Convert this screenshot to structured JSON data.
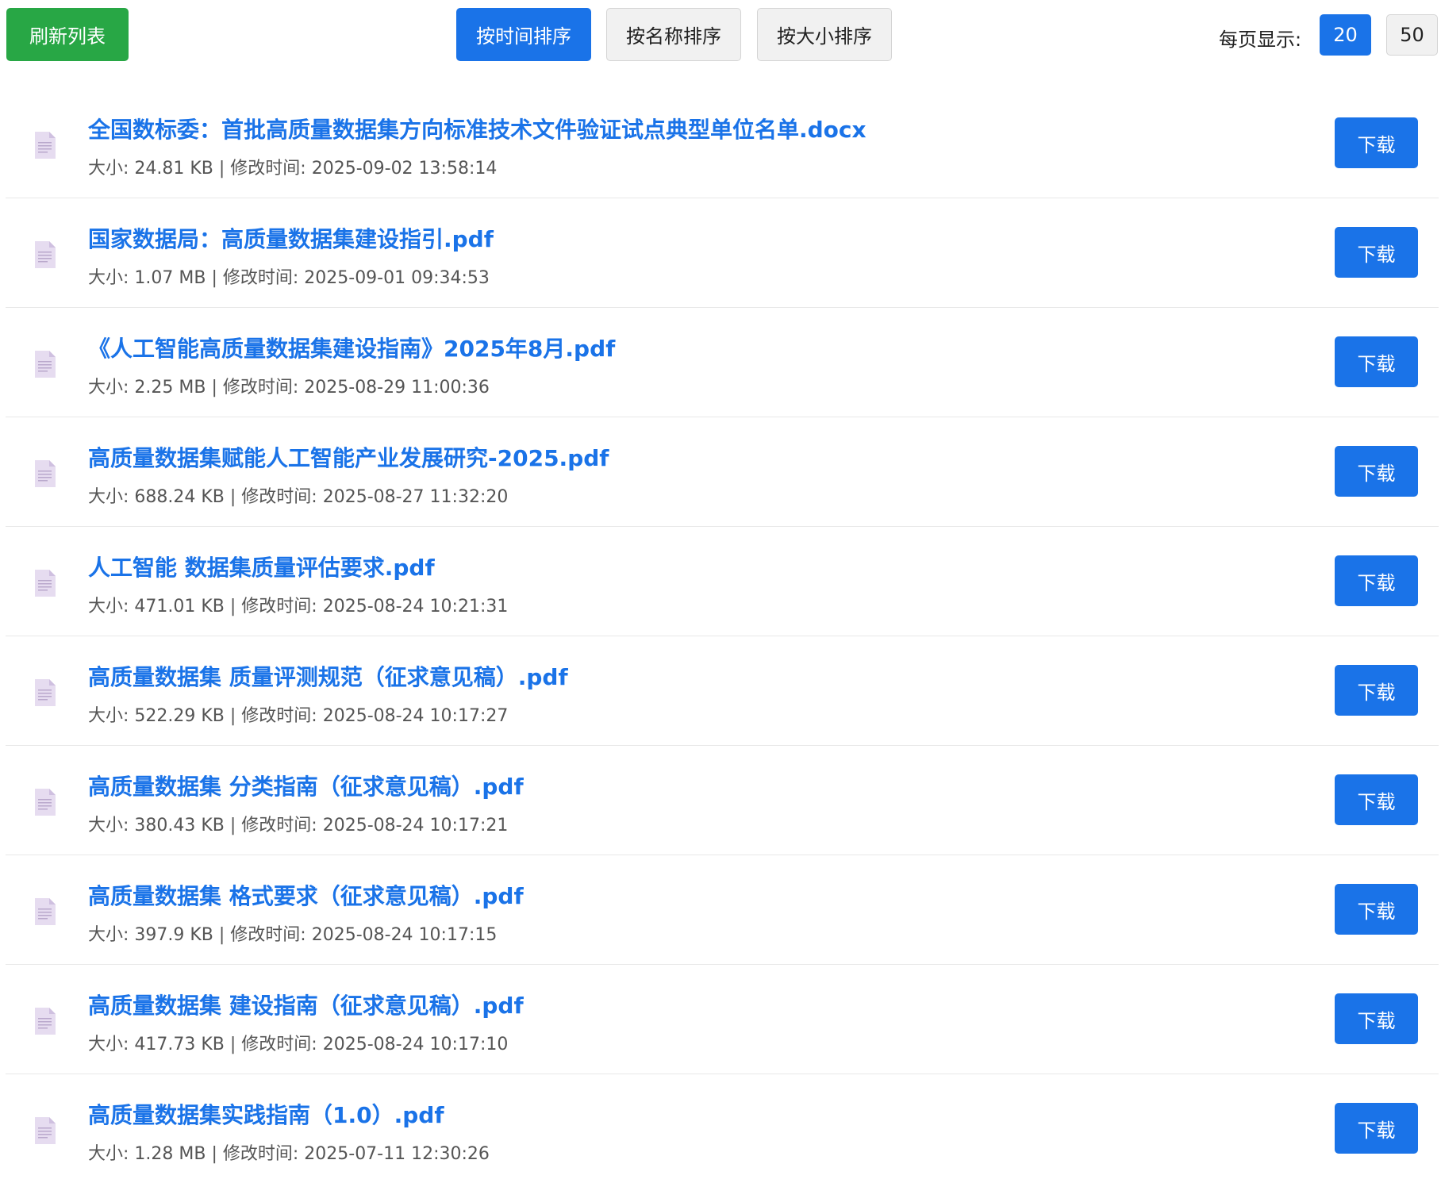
{
  "toolbar": {
    "refresh_label": "刷新列表",
    "sort_by_time_label": "按时间排序",
    "sort_by_name_label": "按名称排序",
    "sort_by_size_label": "按大小排序",
    "active_sort": "time",
    "per_page_label": "每页显示:",
    "per_page_options": [
      "20",
      "50"
    ],
    "per_page_selected": "20"
  },
  "colors": {
    "accent": "#1a73e8",
    "refresh": "#28a745",
    "file_icon": "#e6dcf0"
  },
  "file_icon": "document-icon",
  "download_label": "下载",
  "files": [
    {
      "name": "全国数标委：首批高质量数据集方向标准技术文件验证试点典型单位名单.docx",
      "meta": "大小: 24.81 KB | 修改时间: 2025-09-02 13:58:14"
    },
    {
      "name": "国家数据局：高质量数据集建设指引.pdf",
      "meta": "大小: 1.07 MB | 修改时间: 2025-09-01 09:34:53"
    },
    {
      "name": "《人工智能高质量数据集建设指南》2025年8月.pdf",
      "meta": "大小: 2.25 MB | 修改时间: 2025-08-29 11:00:36"
    },
    {
      "name": "高质量数据集赋能人工智能产业发展研究-2025.pdf",
      "meta": "大小: 688.24 KB | 修改时间: 2025-08-27 11:32:20"
    },
    {
      "name": "人工智能 数据集质量评估要求.pdf",
      "meta": "大小: 471.01 KB | 修改时间: 2025-08-24 10:21:31"
    },
    {
      "name": "高质量数据集 质量评测规范（征求意见稿）.pdf",
      "meta": "大小: 522.29 KB | 修改时间: 2025-08-24 10:17:27"
    },
    {
      "name": "高质量数据集 分类指南（征求意见稿）.pdf",
      "meta": "大小: 380.43 KB | 修改时间: 2025-08-24 10:17:21"
    },
    {
      "name": "高质量数据集 格式要求（征求意见稿）.pdf",
      "meta": "大小: 397.9 KB | 修改时间: 2025-08-24 10:17:15"
    },
    {
      "name": "高质量数据集 建设指南（征求意见稿）.pdf",
      "meta": "大小: 417.73 KB | 修改时间: 2025-08-24 10:17:10"
    },
    {
      "name": "高质量数据集实践指南（1.0）.pdf",
      "meta": "大小: 1.28 MB | 修改时间: 2025-07-11 12:30:26"
    }
  ]
}
